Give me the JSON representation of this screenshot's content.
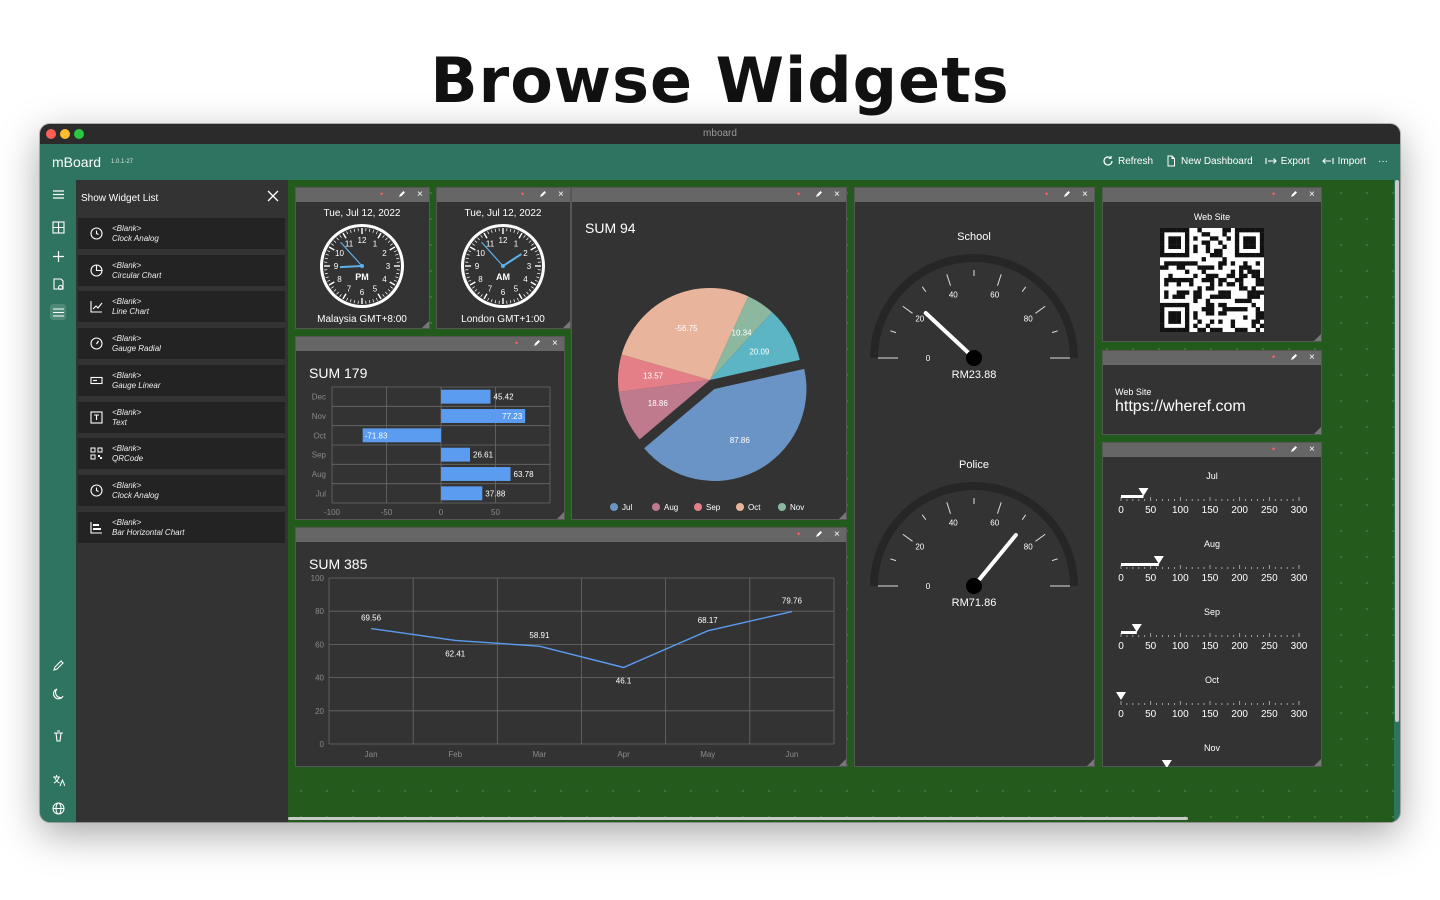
{
  "headline": "Browse Widgets",
  "window": {
    "title": "mboard"
  },
  "app": {
    "name": "mBoard",
    "version": "1.0.1-27"
  },
  "toolbar": {
    "refresh": "Refresh",
    "new_dashboard": "New Dashboard",
    "export": "Export",
    "import": "Import",
    "more": "···"
  },
  "panel": {
    "title": "Show Widget List",
    "items": [
      {
        "blank": "<Blank>",
        "type": "Clock Analog",
        "icon": "clock-icon"
      },
      {
        "blank": "<Blank>",
        "type": "Circular Chart",
        "icon": "pie-chart-icon"
      },
      {
        "blank": "<Blank>",
        "type": "Line Chart",
        "icon": "line-chart-icon"
      },
      {
        "blank": "<Blank>",
        "type": "Gauge Radial",
        "icon": "gauge-radial-icon"
      },
      {
        "blank": "<Blank>",
        "type": "Gauge Linear",
        "icon": "gauge-linear-icon"
      },
      {
        "blank": "<Blank>",
        "type": "Text",
        "icon": "text-icon"
      },
      {
        "blank": "<Blank>",
        "type": "QRCode",
        "icon": "qrcode-icon"
      },
      {
        "blank": "<Blank>",
        "type": "Clock Analog",
        "icon": "clock-icon"
      },
      {
        "blank": "<Blank>",
        "type": "Bar Horizontal Chart",
        "icon": "bar-chart-icon"
      }
    ]
  },
  "clocks": [
    {
      "date": "Tue, Jul 12, 2022",
      "ampm": "PM",
      "label": "Malaysia GMT+8:00",
      "hour": 8.9,
      "minute": 53
    },
    {
      "date": "Tue, Jul 12, 2022",
      "ampm": "AM",
      "label": "London GMT+1:00",
      "hour": 1.9,
      "minute": 53
    }
  ],
  "clock_numbers": [
    "12",
    "1",
    "2",
    "3",
    "4",
    "5",
    "6",
    "7",
    "8",
    "9",
    "10",
    "11"
  ],
  "gauges": [
    {
      "title": "School",
      "value_text": "RM23.88",
      "value": 23.88
    },
    {
      "title": "Police",
      "value_text": "RM71.86",
      "value": 71.86
    }
  ],
  "gauge_ticks": [
    "0",
    "20",
    "40",
    "60",
    "80"
  ],
  "qr": {
    "label": "Web Site"
  },
  "text_widget": {
    "label": "Web Site",
    "value": "https://wheref.com"
  },
  "linear": {
    "ticks": [
      "0",
      "50",
      "100",
      "150",
      "200",
      "250",
      "300"
    ],
    "max": 300,
    "rows": [
      {
        "label": "Jul",
        "value": 37.88
      },
      {
        "label": "Aug",
        "value": 63.78
      },
      {
        "label": "Sep",
        "value": 26.61
      },
      {
        "label": "Oct",
        "value": 0
      },
      {
        "label": "Nov",
        "value": 77.23
      }
    ]
  },
  "chart_data": [
    {
      "type": "bar",
      "orientation": "horizontal",
      "title": "SUM 179",
      "categories": [
        "Dec",
        "Nov",
        "Oct",
        "Sep",
        "Aug",
        "Jul"
      ],
      "values": [
        45.42,
        77.23,
        -71.83,
        26.61,
        63.78,
        37.88
      ],
      "xlim": [
        -100,
        100
      ],
      "xticks": [
        "-100",
        "-50",
        "0",
        "50"
      ],
      "grid": true,
      "color": "#5b9cf0"
    },
    {
      "type": "pie",
      "title": "SUM 94",
      "slices": [
        {
          "label": "",
          "value": 87.86,
          "color": "#6b94c6",
          "exploded": true
        },
        {
          "label": "",
          "value": 18.86,
          "color": "#c07a8e"
        },
        {
          "label": "",
          "value": 13.57,
          "color": "#e57f87"
        },
        {
          "label": "",
          "value": -56.75,
          "color": "#e8b49c"
        },
        {
          "label": "",
          "value": 10.34,
          "color": "#8cb89f"
        },
        {
          "label": "",
          "value": 20.09,
          "color": "#5bb5c4"
        }
      ],
      "legend": [
        {
          "name": "Jul",
          "color": "#6b94c6"
        },
        {
          "name": "Aug",
          "color": "#c07a8e"
        },
        {
          "name": "Sep",
          "color": "#e57f87"
        },
        {
          "name": "Oct",
          "color": "#e8b49c"
        },
        {
          "name": "Nov",
          "color": "#8cb89f"
        }
      ],
      "legend_position": "bottom"
    },
    {
      "type": "line",
      "title": "SUM 385",
      "categories": [
        "Jan",
        "Feb",
        "Mar",
        "Apr",
        "May",
        "Jun"
      ],
      "values": [
        69.56,
        62.41,
        58.91,
        46.1,
        68.17,
        79.76
      ],
      "ylim": [
        0,
        100
      ],
      "yticks": [
        "0",
        "20",
        "40",
        "60",
        "80",
        "100"
      ],
      "grid": true,
      "color": "#5b9cf0"
    }
  ]
}
